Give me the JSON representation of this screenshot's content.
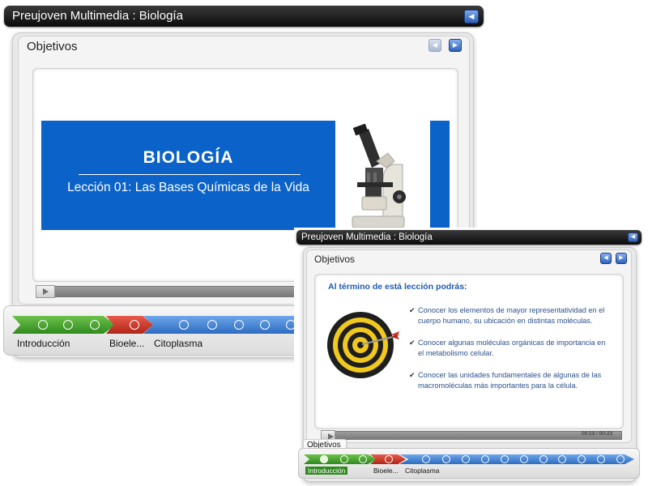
{
  "back_window": {
    "title": "Preujoven Multimedia : Biología",
    "section_title": "Objetivos",
    "slide": {
      "heading": "BIOLOGÍA",
      "subtitle": "Lección 01: Las Bases Químicas de la Vida",
      "image": "microscope-image"
    },
    "timeline": {
      "labels": [
        "Introducción",
        "Bioele...",
        "Citoplasma"
      ]
    }
  },
  "front_window": {
    "title": "Preujoven Multimedia : Biología",
    "section_title": "Objetivos",
    "slide": {
      "heading": "Al término de está lección podrás:",
      "objectives": [
        "Conocer los elementos de mayor representatividad en el cuerpo humano, su ubicación en distintas moléculas.",
        "Conocer algunas moléculas orgánicas de importancia en el metabolismo celular.",
        "Conocer las unidades fundamentales de algunas de las macromoléculas más importantes para la célula."
      ],
      "image": "target-dartboard-image"
    },
    "time_display": "00:23 / 00:23",
    "timeline": {
      "tooltip": "Objetivos",
      "labels": [
        "Introducción",
        "Bioele...",
        "Citoplasma"
      ]
    }
  },
  "colors": {
    "slide_blue": "#0b63c9",
    "segment_green": "#3f9a2a",
    "segment_red": "#c9392b",
    "segment_blue": "#3a7fd0",
    "text_blue": "#2c4f8c"
  }
}
